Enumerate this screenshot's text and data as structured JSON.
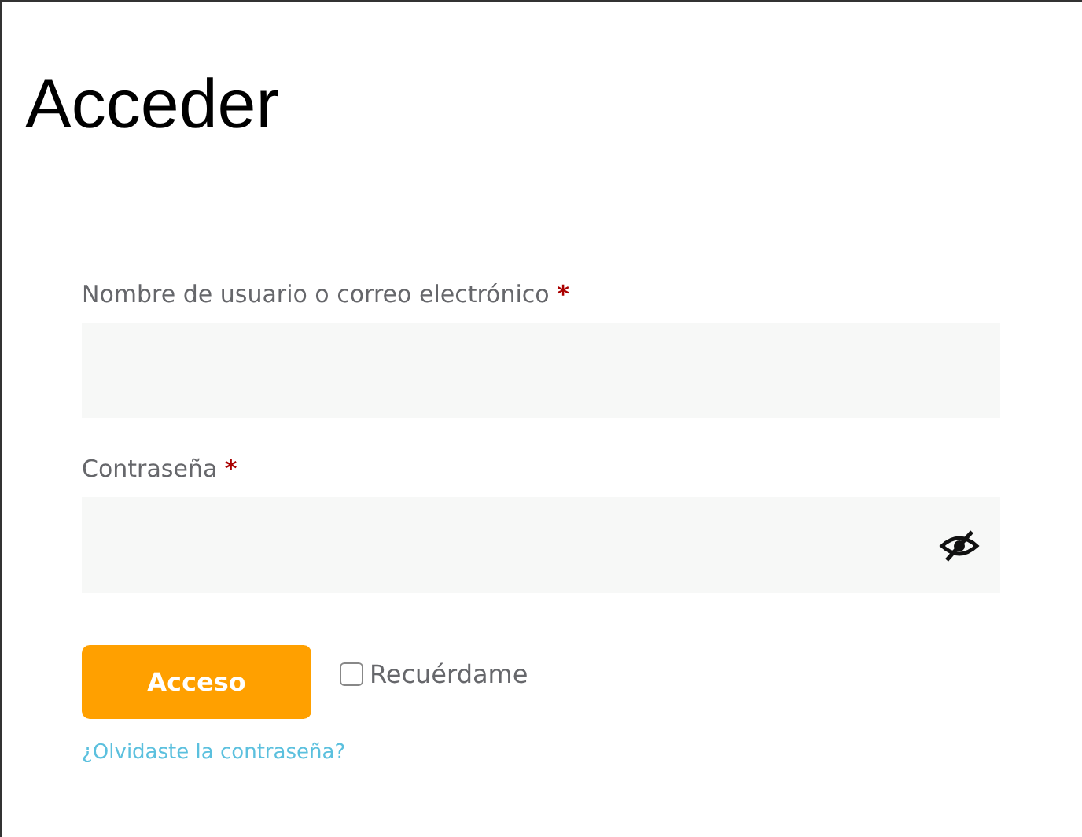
{
  "title": "Acceder",
  "fields": [
    {
      "label": "Nombre de usuario o correo electrónico",
      "required_mark": "*",
      "kind": "text"
    },
    {
      "label": "Contraseña",
      "required_mark": "*",
      "kind": "password"
    }
  ],
  "submit": {
    "label": "Acceso"
  },
  "remember": {
    "label": "Recuérdame",
    "checked": false
  },
  "forgot_link": "¿Olvidaste la contraseña?"
}
